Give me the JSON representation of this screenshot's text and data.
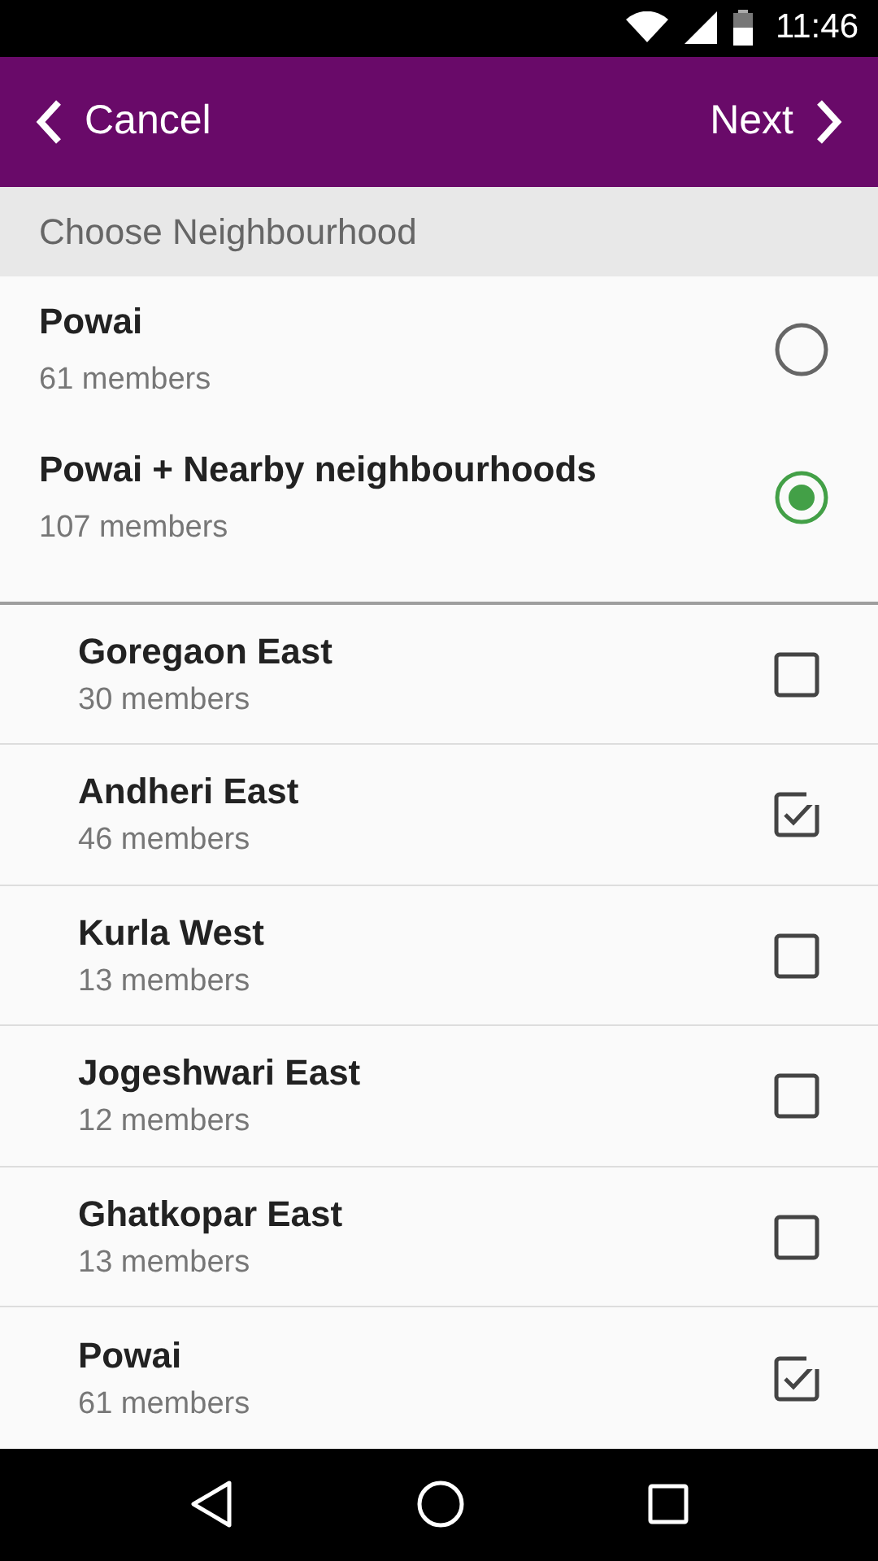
{
  "status_bar": {
    "time": "11:46"
  },
  "toolbar": {
    "back": "Cancel",
    "next": "Next"
  },
  "section_title": "Choose Neighbourhood",
  "options": [
    {
      "name": "Powai",
      "members": "61 members",
      "selected": false
    },
    {
      "name": "Powai + Nearby neighbourhoods",
      "members": "107 members",
      "selected": true
    }
  ],
  "neighbourhoods": [
    {
      "name": "Goregaon East",
      "members": "30 members",
      "checked": false
    },
    {
      "name": "Andheri East",
      "members": "46 members",
      "checked": true
    },
    {
      "name": "Kurla West",
      "members": "13 members",
      "checked": false
    },
    {
      "name": "Jogeshwari East",
      "members": "12 members",
      "checked": false
    },
    {
      "name": "Ghatkopar East",
      "members": "13 members",
      "checked": false
    },
    {
      "name": "Powai",
      "members": "61 members",
      "checked": true
    }
  ]
}
